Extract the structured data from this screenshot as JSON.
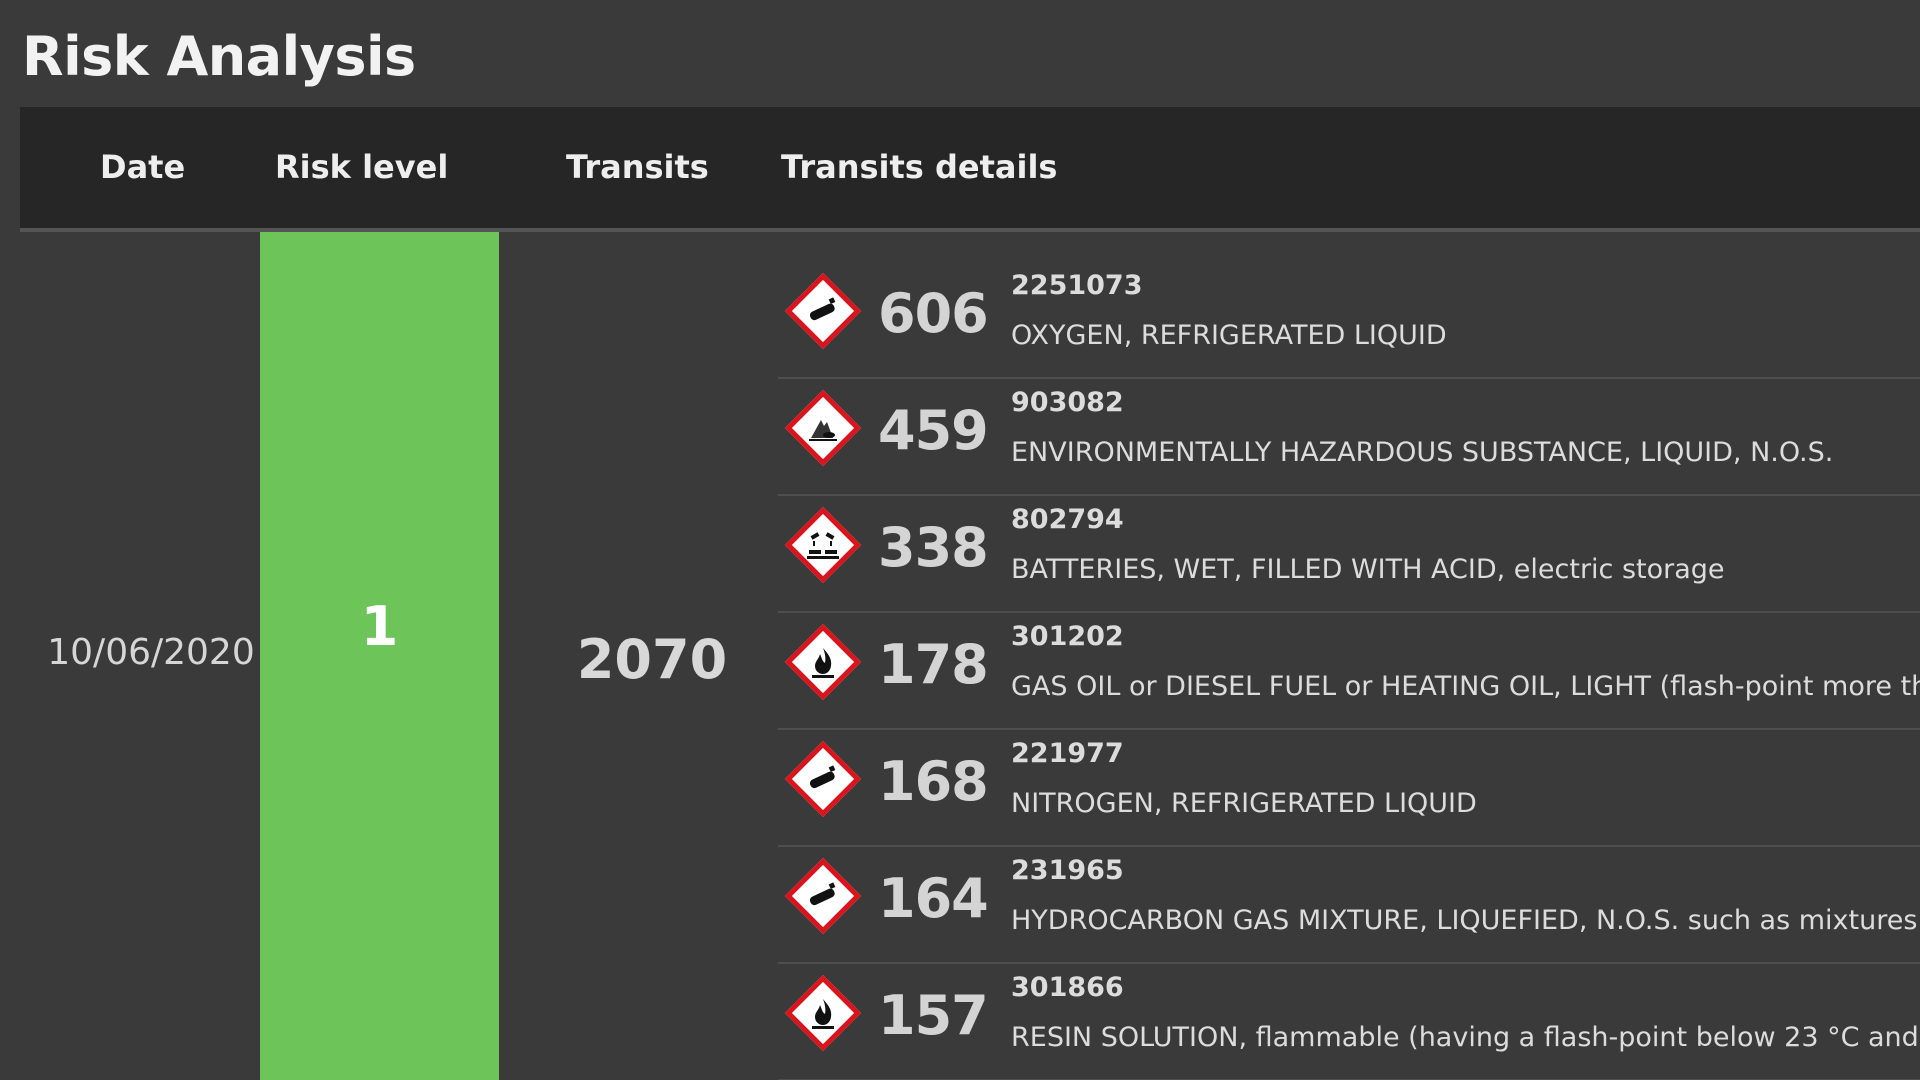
{
  "page": {
    "title": "Risk Analysis"
  },
  "table": {
    "headers": {
      "date": "Date",
      "risk_level": "Risk level",
      "transits": "Transits",
      "transits_details": "Transits details"
    },
    "row": {
      "date": "10/06/2020",
      "risk_level": "1",
      "risk_color": "#6dc55a",
      "transits": "2070",
      "details": [
        {
          "icon": "gas-cylinder-icon",
          "count": "606",
          "code": "2251073",
          "name": "OXYGEN, REFRIGERATED LIQUID"
        },
        {
          "icon": "environment-hazard-icon",
          "count": "459",
          "code": "903082",
          "name": "ENVIRONMENTALLY HAZARDOUS SUBSTANCE, LIQUID, N.O.S."
        },
        {
          "icon": "corrosive-icon",
          "count": "338",
          "code": "802794",
          "name": "BATTERIES, WET, FILLED WITH ACID, electric storage"
        },
        {
          "icon": "flame-icon",
          "count": "178",
          "code": "301202",
          "name": "GAS OIL or DIESEL FUEL or HEATING OIL, LIGHT (flash-point more th"
        },
        {
          "icon": "gas-cylinder-icon",
          "count": "168",
          "code": "221977",
          "name": "NITROGEN, REFRIGERATED LIQUID"
        },
        {
          "icon": "gas-cylinder-icon",
          "count": "164",
          "code": "231965",
          "name": "HYDROCARBON GAS MIXTURE, LIQUEFIED, N.O.S. such as mixtures"
        },
        {
          "icon": "flame-icon",
          "count": "157",
          "code": "301866",
          "name": "RESIN SOLUTION, flammable (having a flash-point below 23 °C and"
        }
      ]
    }
  },
  "colors": {
    "background": "#3a3a3a",
    "header_bg": "#262626",
    "pictogram_border": "#d9141c"
  }
}
